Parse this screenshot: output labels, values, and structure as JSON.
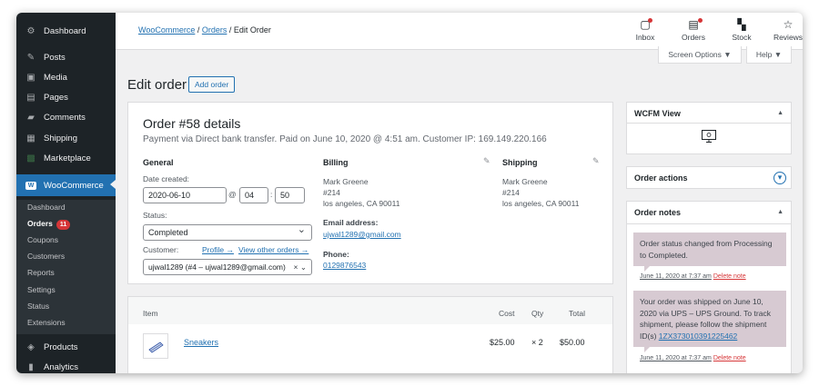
{
  "sidebar": {
    "items": [
      {
        "label": "Dashboard",
        "icon": "dashboard-icon",
        "glyph": "⚙"
      },
      {
        "label": "Posts",
        "icon": "pin-icon",
        "glyph": "✎"
      },
      {
        "label": "Media",
        "icon": "media-icon",
        "glyph": "▣"
      },
      {
        "label": "Pages",
        "icon": "pages-icon",
        "glyph": "▤"
      },
      {
        "label": "Comments",
        "icon": "comments-icon",
        "glyph": "▰"
      },
      {
        "label": "Shipping",
        "icon": "grid-icon",
        "glyph": "▦"
      },
      {
        "label": "Marketplace",
        "icon": "marketplace-icon",
        "glyph": "▩"
      },
      {
        "label": "WooCommerce",
        "icon": "woo-icon",
        "glyph": "W"
      }
    ],
    "submenu": [
      "Dashboard",
      "Orders",
      "Coupons",
      "Customers",
      "Reports",
      "Settings",
      "Status",
      "Extensions"
    ],
    "orders_badge": "11",
    "bottom": [
      {
        "label": "Products",
        "icon": "box-icon",
        "glyph": "◈"
      },
      {
        "label": "Analytics",
        "icon": "bar-chart-icon",
        "glyph": "▮"
      }
    ]
  },
  "topbar": {
    "crumb_1": "WooCommerce",
    "crumb_sep_1": " / ",
    "crumb_2": "Orders",
    "crumb_sep_2": " / ",
    "crumb_3": "Edit Order",
    "buttons": [
      {
        "label": "Inbox",
        "icon": "inbox-icon",
        "glyph": "▢"
      },
      {
        "label": "Orders",
        "icon": "orders-icon",
        "glyph": "▤"
      },
      {
        "label": "Stock",
        "icon": "stock-icon",
        "glyph": "▚"
      },
      {
        "label": "Reviews",
        "icon": "star-icon",
        "glyph": "☆"
      }
    ]
  },
  "screen_options": {
    "label": "Screen Options ▼",
    "help": "Help ▼"
  },
  "page": {
    "title": "Edit order",
    "add_order": "Add order"
  },
  "order": {
    "heading": "Order #58 details",
    "subheading": "Payment via Direct bank transfer. Paid on June 10, 2020 @ 4:51 am. Customer IP: 169.149.220.166",
    "general": {
      "title": "General",
      "date_label": "Date created:",
      "date": "2020-06-10",
      "at": "@",
      "hour": "04",
      "colon": ":",
      "minute": "50",
      "status_label": "Status:",
      "status": "Completed",
      "customer_label": "Customer:",
      "profile_link": "Profile →",
      "other_orders_link": "View other orders →",
      "customer": "ujwal1289 (#4 – ujwal1289@gmail.com)",
      "clear": "× ⌄"
    },
    "billing": {
      "title": "Billing",
      "line1": "Mark Greene",
      "line2": "#214",
      "line3": "los angeles, CA 90011",
      "email_label": "Email address:",
      "email": "ujwal1289@gmail.com",
      "phone_label": "Phone:",
      "phone": "0129876543"
    },
    "shipping": {
      "title": "Shipping",
      "line1": "Mark Greene",
      "line2": "#214",
      "line3": "los angeles, CA 90011"
    }
  },
  "items_table": {
    "headers": {
      "item": "Item",
      "cost": "Cost",
      "qty": "Qty",
      "total": "Total"
    },
    "row": {
      "name": "Sneakers",
      "cost": "$25.00",
      "qty": "× 2",
      "total": "$50.00"
    }
  },
  "wcfm": {
    "title": "WCFM View",
    "toggle": "▲"
  },
  "order_actions": {
    "title": "Order actions",
    "toggle": "▾"
  },
  "order_notes": {
    "title": "Order notes",
    "toggle": "▲",
    "note1": {
      "text": "Order status changed from Processing to Completed.",
      "date": "June 11, 2020 at 7:37 am",
      "delete": "Delete note"
    },
    "note2": {
      "text_before": "Your order was shipped on June 10, 2020 via UPS – UPS Ground. To track shipment, please follow the shipment ID(s) ",
      "tracking": "1ZX373010391225462",
      "date": "June 11, 2020 at 7:37 am",
      "delete": "Delete note"
    }
  },
  "colors": {
    "accent": "#2271b1",
    "sidebar": "#1d2327",
    "note_bg": "#d7cad2",
    "badge": "#d63638"
  }
}
